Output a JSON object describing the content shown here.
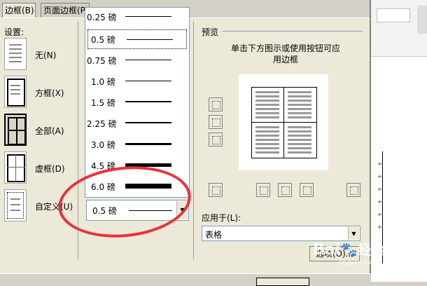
{
  "tabs": [
    {
      "label": "边框(B)"
    },
    {
      "label": "页面边框(P)"
    }
  ],
  "settings": {
    "title": "设置:",
    "items": [
      {
        "label": "无(N)"
      },
      {
        "label": "方框(X)"
      },
      {
        "label": "全部(A)"
      },
      {
        "label": "虚框(D)"
      },
      {
        "label": "自定义(U)"
      }
    ]
  },
  "line_style_list": {
    "items": [
      {
        "label": "0.25 磅"
      },
      {
        "label": "0.5 磅"
      },
      {
        "label": "0.75 磅"
      },
      {
        "label": "1.0 磅"
      },
      {
        "label": "1.5 磅"
      },
      {
        "label": "2.25 磅"
      },
      {
        "label": "3.0 磅"
      },
      {
        "label": "4.5 磅"
      },
      {
        "label": "6.0 磅"
      }
    ],
    "selected_index": 1,
    "current_value": "0.5 磅"
  },
  "preview": {
    "title": "预览",
    "instruction": "单击下方图示或使用按钮可应用边框"
  },
  "apply_to": {
    "label": "应用于(L):",
    "value": "表格"
  },
  "options_button": "选项(O)...",
  "watermark": {
    "brand": "Bai",
    "brand2": "经验",
    "url": "jingyan.baidu.com"
  },
  "colors": {
    "annotation_oval": "#e8313c"
  }
}
